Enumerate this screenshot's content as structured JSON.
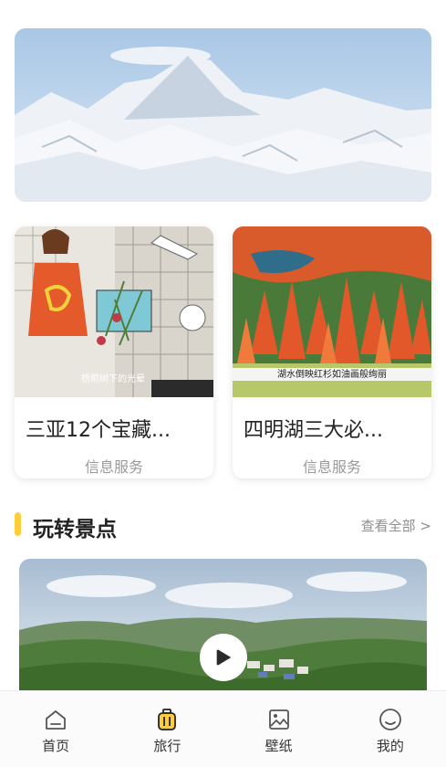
{
  "cards": [
    {
      "title": "三亚12个宝藏...",
      "subtitle": "信息服务",
      "thumb_caption": "梧桐树下的光晕"
    },
    {
      "title": "四明湖三大必...",
      "subtitle": "信息服务",
      "thumb_caption": "湖水倒映红杉如油画般绚丽"
    }
  ],
  "section": {
    "title": "玩转景点",
    "more": "查看全部 >"
  },
  "tabs": [
    {
      "label": "首页",
      "icon": "home-icon"
    },
    {
      "label": "旅行",
      "icon": "luggage-icon"
    },
    {
      "label": "壁纸",
      "icon": "image-icon"
    },
    {
      "label": "我的",
      "icon": "smile-icon"
    }
  ],
  "colors": {
    "accent": "#ffce3b",
    "text": "#222222",
    "muted": "#9a9a9a"
  }
}
